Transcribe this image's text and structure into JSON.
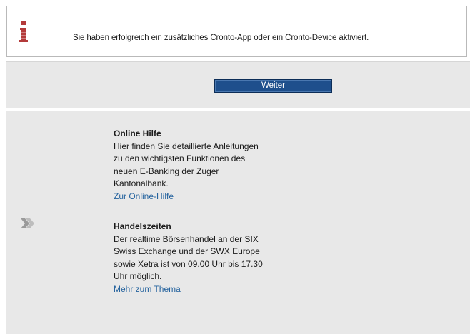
{
  "notice": {
    "icon": "info-icon",
    "icon_color": "#b33a3a",
    "message": "Sie haben erfolgreich ein zusätzliches Cronto-App oder ein Cronto-Device aktiviert."
  },
  "actions": {
    "continue_label": "Weiter",
    "button_color": "#1e4f8c"
  },
  "info": {
    "chevron_icon": "double-chevron-right-icon",
    "sections": [
      {
        "title": "Online Hilfe",
        "lines": [
          "Hier finden Sie detaillierte Anleitungen",
          "zu den wichtigsten Funktionen des",
          "neuen E-Banking der Zuger",
          "Kantonalbank."
        ],
        "link": "Zur Online-Hilfe"
      },
      {
        "title": "Handelszeiten",
        "lines": [
          "Der realtime Börsenhandel an der SIX",
          "Swiss Exchange und der SWX Europe",
          "sowie Xetra ist von 09.00 Uhr bis 17.30",
          "Uhr möglich."
        ],
        "link": "Mehr zum Thema"
      }
    ],
    "link_color": "#25639e"
  }
}
